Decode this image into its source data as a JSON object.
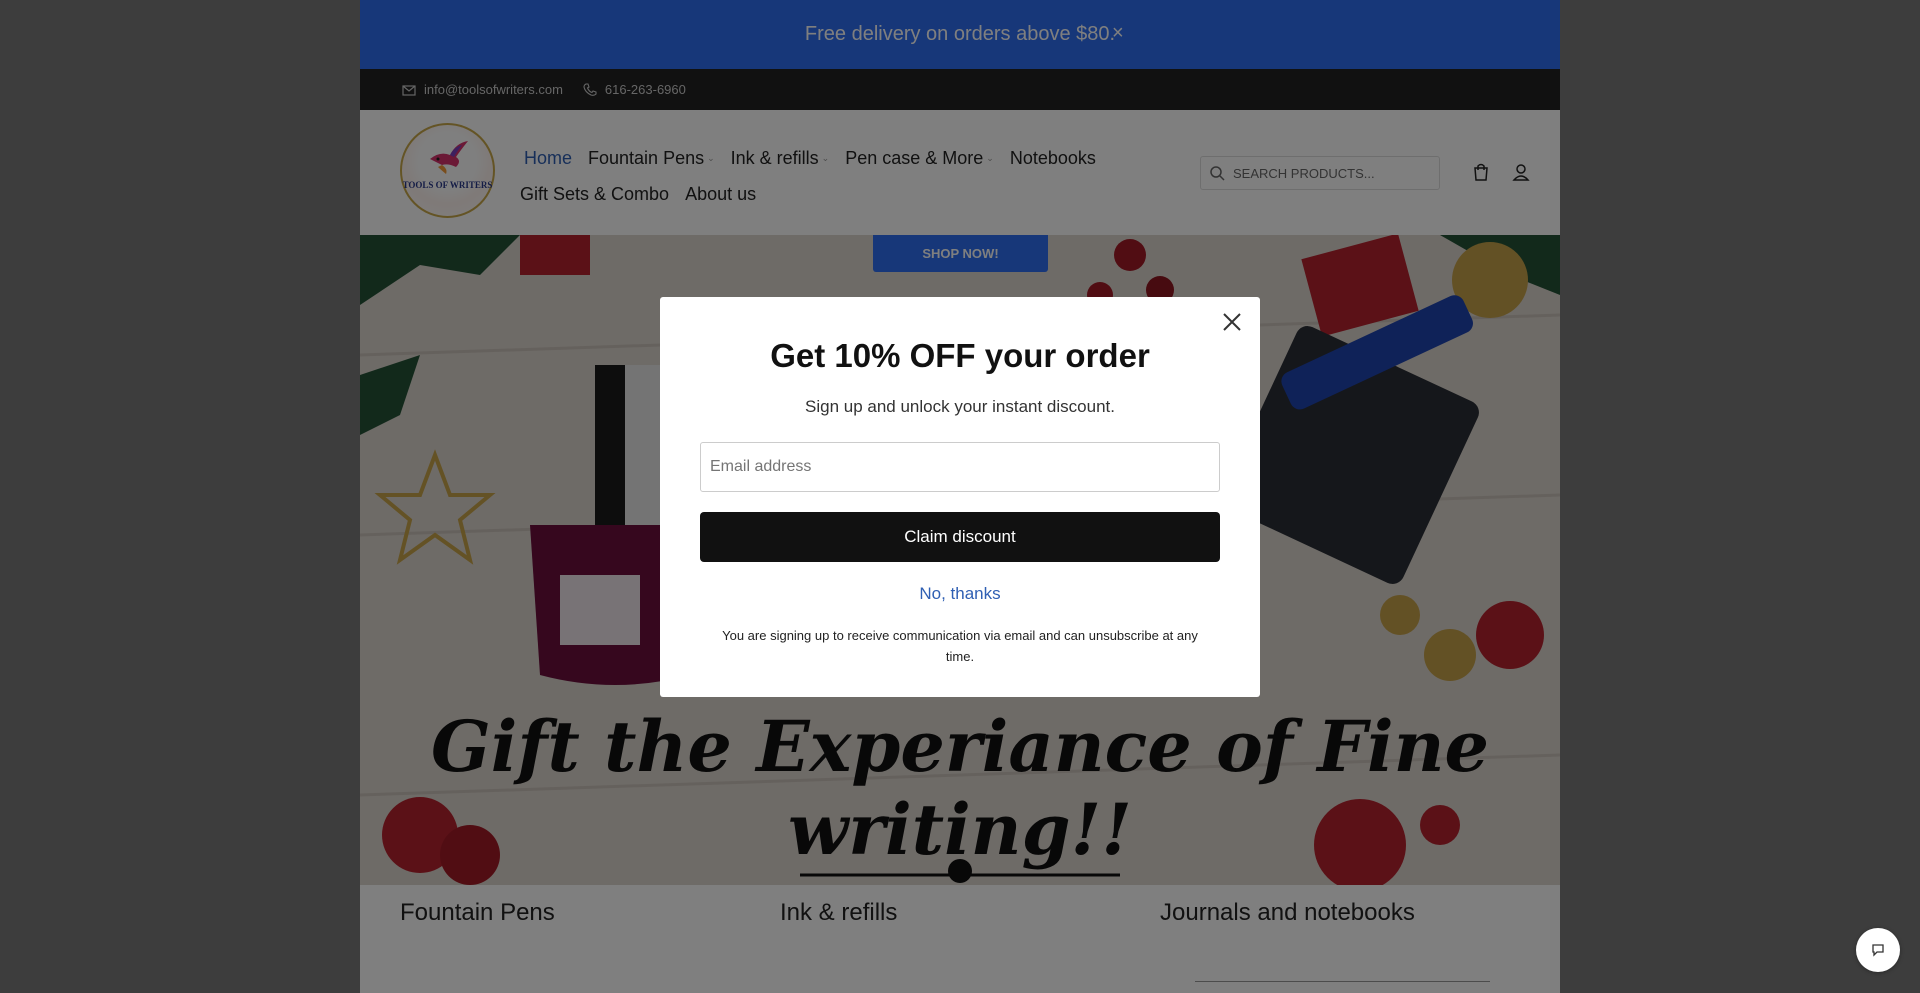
{
  "announcement": {
    "text": "Free delivery on orders above $80.",
    "close": "×"
  },
  "topbar": {
    "email": "info@toolsofwriters.com",
    "phone": "616-263-6960"
  },
  "logo": {
    "text": "TOOLS OF WRITERS"
  },
  "nav": {
    "row1": [
      {
        "label": "Home",
        "active": true,
        "dropdown": false
      },
      {
        "label": "Fountain Pens",
        "dropdown": true
      },
      {
        "label": "Ink & refills",
        "dropdown": true
      },
      {
        "label": "Pen case & More",
        "dropdown": true
      },
      {
        "label": "Notebooks",
        "dropdown": false
      }
    ],
    "row2": [
      {
        "label": "Gift Sets & Combo",
        "dropdown": false
      },
      {
        "label": "About us",
        "dropdown": false
      }
    ]
  },
  "search": {
    "placeholder": "SEARCH PRODUCTS..."
  },
  "hero": {
    "button": "SHOP NOW!",
    "title": "Gift the Experiance of Fine writing!!"
  },
  "categories": [
    "Fountain Pens",
    "Ink & refills",
    "Journals and notebooks"
  ],
  "modal": {
    "title": "Get 10% OFF your order",
    "subtitle": "Sign up and unlock your instant discount.",
    "email_placeholder": "Email address",
    "claim_label": "Claim discount",
    "decline_label": "No, thanks",
    "disclaimer": "You are signing up to receive communication via email and can unsubscribe at any time."
  },
  "colors": {
    "brand_blue": "#2f6ff2",
    "topbar": "#222222",
    "link_blue": "#2f5fb3"
  }
}
